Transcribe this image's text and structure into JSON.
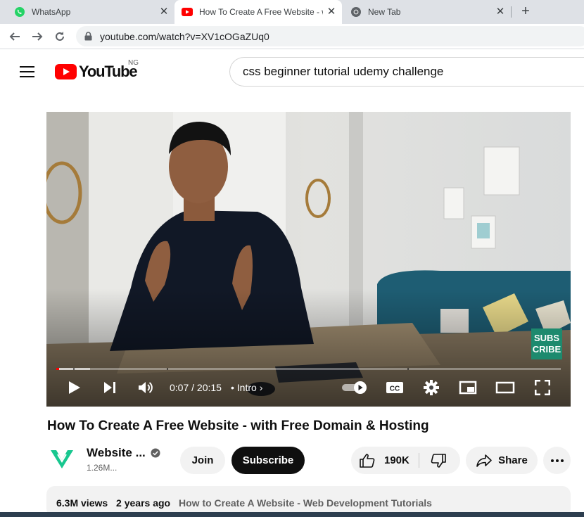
{
  "browser": {
    "tabs": [
      {
        "title": "WhatsApp",
        "icon": "whatsapp-icon",
        "active": false
      },
      {
        "title": "How To Create A Free Website - w",
        "icon": "youtube-icon",
        "active": true
      },
      {
        "title": "New Tab",
        "icon": "chrome-icon",
        "active": false
      }
    ],
    "url": "youtube.com/watch?v=XV1cOGaZUq0"
  },
  "masthead": {
    "logo_text": "YouTube",
    "country_code": "NG",
    "search_query": "css beginner tutorial udemy challenge"
  },
  "player": {
    "time": "0:07 / 20:15",
    "chapter": "• Intro",
    "progress": 0.006,
    "overlay_badge": "SUBS\nCRIBE"
  },
  "video": {
    "title": "How To Create A Free Website - with Free Domain & Hosting",
    "channel_name": "Website ...",
    "subscribers": "1.26M...",
    "join_label": "Join",
    "subscribe_label": "Subscribe",
    "likes": "190K",
    "share_label": "Share",
    "views": "6.3M views",
    "date": "2 years ago",
    "playlist": "How to Create A Website - Web Development Tutorials"
  },
  "colors": {
    "brand": "#ff0000",
    "text": "#0f0f0f",
    "secondary_text": "#606060",
    "chip": "#f2f2f2"
  }
}
